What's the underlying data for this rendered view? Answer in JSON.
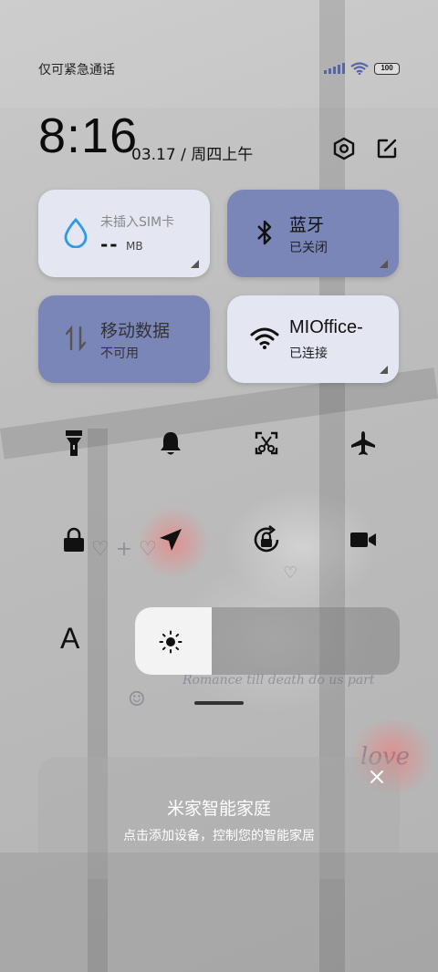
{
  "status_bar": {
    "carrier": "仅可紧急通话",
    "battery": "100",
    "signal_icon": "signal-bars-icon",
    "wifi_icon": "wifi-icon"
  },
  "header": {
    "time": "8:16",
    "date": "03.17 / 周四上午",
    "settings_icon": "settings-hex-icon",
    "edit_icon": "edit-icon"
  },
  "tiles": [
    {
      "title": "未插入SIM卡",
      "value": "--",
      "unit": "MB",
      "icon": "water-drop-icon",
      "style": "light"
    },
    {
      "title": "蓝牙",
      "sub": "已关闭",
      "icon": "bluetooth-icon",
      "style": "dark"
    },
    {
      "title": "移动数据",
      "sub": "不可用",
      "icon": "data-arrows-icon",
      "style": "dark"
    },
    {
      "title": "MIOffice-",
      "sub": "已连接",
      "icon": "wifi-icon",
      "style": "light"
    }
  ],
  "quick_toggles": [
    {
      "name": "flashlight-icon"
    },
    {
      "name": "bell-icon"
    },
    {
      "name": "screenshot-icon"
    },
    {
      "name": "airplane-icon"
    },
    {
      "name": "lock-icon"
    },
    {
      "name": "location-arrow-icon"
    },
    {
      "name": "rotation-lock-icon"
    },
    {
      "name": "video-camera-icon"
    }
  ],
  "brightness": {
    "level": 0.29,
    "icon": "sun-icon",
    "font_label": "A"
  },
  "smart_home": {
    "title": "米家智能家庭",
    "subtitle": "点击添加设备，控制您的智能家居",
    "close_icon": "close-icon"
  },
  "colors": {
    "accent_dark_tile": "#7a85b8",
    "light_tile": "#e4e6f2",
    "drop_blue": "#2f9be8"
  }
}
